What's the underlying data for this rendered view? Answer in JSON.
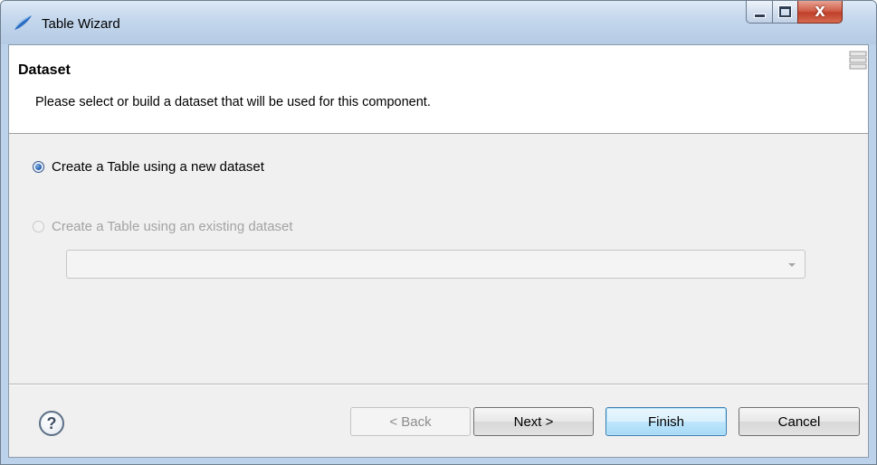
{
  "window": {
    "title": "Table Wizard",
    "app_icon": "eclipse-birt-icon",
    "controls": {
      "minimize": "minimize-icon",
      "maximize": "maximize-icon",
      "close_label": "X"
    }
  },
  "page": {
    "title": "Dataset",
    "description": "Please select or build a dataset that will be used for this component."
  },
  "options": [
    {
      "label": "Create a Table using a new dataset",
      "checked": true,
      "enabled": true
    },
    {
      "label": "Create a Table using an existing dataset",
      "checked": false,
      "enabled": false
    }
  ],
  "dataset_combo": {
    "value": "",
    "enabled": false
  },
  "footer": {
    "help_label": "?",
    "back_label": "< Back",
    "next_label": "Next >",
    "finish_label": "Finish",
    "cancel_label": "Cancel"
  }
}
